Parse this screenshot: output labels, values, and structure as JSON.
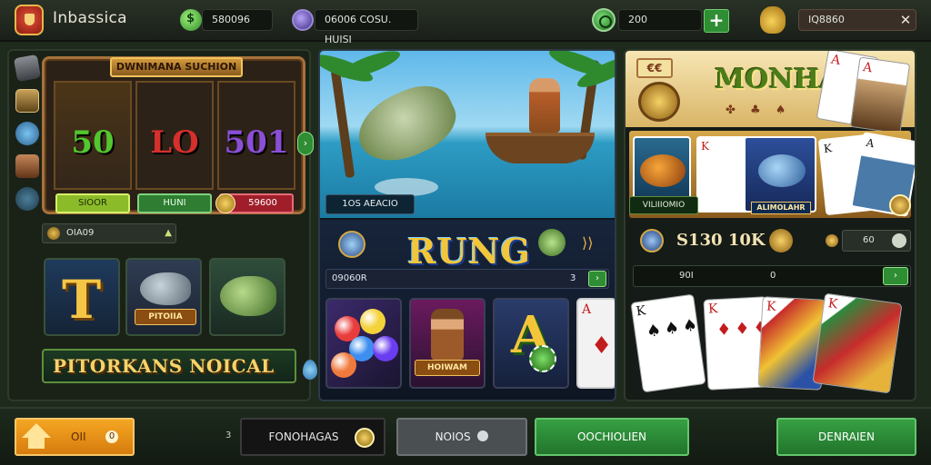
{
  "header": {
    "brand": "Inbassica",
    "balance_1": "580096",
    "balance_2": "06006 COSU. HUISI",
    "coins": "200",
    "plus_label": "+",
    "profile": "IQ8860",
    "close_label": "✕"
  },
  "slot": {
    "title": "DWNIMANA SUCHION",
    "reels": [
      {
        "value": "50",
        "color": "#52c72e",
        "button": "SIOOR"
      },
      {
        "value": "LO",
        "color": "#d6302c",
        "button": "HUNI"
      },
      {
        "value": "501",
        "color": "#8a4fd6",
        "button": "59600"
      }
    ],
    "arrow": "›",
    "info_value": "OIA09",
    "info_arrow": "▲",
    "tiles": [
      {
        "letter": "T"
      },
      {
        "label": "PITOIIA"
      },
      {
        "label": ""
      }
    ],
    "banner": "PITORKANS NOICAL"
  },
  "fishing": {
    "scene_label": "1OS AEACIO",
    "title": "RUNG",
    "arrow": "⟩⟩",
    "row_label": "09060R",
    "row_value": "3",
    "row_btn": "›",
    "tiles": [
      {
        "label": ""
      },
      {
        "label": "HOIWAM"
      },
      {
        "label": ""
      },
      {
        "corner": "A",
        "pip": "♦"
      }
    ]
  },
  "poker": {
    "badge": "€€",
    "title": "MONHAI",
    "suits": "✤ ♣ ♠",
    "promo_cards": [
      {
        "corner": "A"
      },
      {
        "corner": "A"
      }
    ],
    "row_cards": [
      {
        "label": ""
      },
      {
        "corner": "K"
      },
      {
        "label": "ALIMOLAHR"
      },
      {
        "corner": "K"
      },
      {
        "corner": "A"
      }
    ],
    "sub_label": "VILIIIOMIO",
    "stat_value": "S130 10K",
    "pill_value": "60",
    "rr_label": "90I",
    "rr_value": "0",
    "rr_btn": "›",
    "hand": [
      {
        "corner": "K",
        "pips": "♠♠♠♠♠♠"
      },
      {
        "corner": "K",
        "pips": "♦♦♦♦♦♦"
      },
      {
        "corner": "K",
        "pips": ""
      },
      {
        "corner": "K",
        "pips": ""
      }
    ]
  },
  "footer": {
    "home_label": "OII",
    "home_badge": "0",
    "tick": "3",
    "btn_dark": "FONOHAGAS",
    "btn_gray": "NOIOS",
    "btn_green_1": "OOCHIOLIEN",
    "btn_green_2": "DENRAIEN"
  },
  "colors": {
    "accent_green": "#2f8d34",
    "accent_orange": "#f5a623",
    "gold": "#f3c63a"
  }
}
